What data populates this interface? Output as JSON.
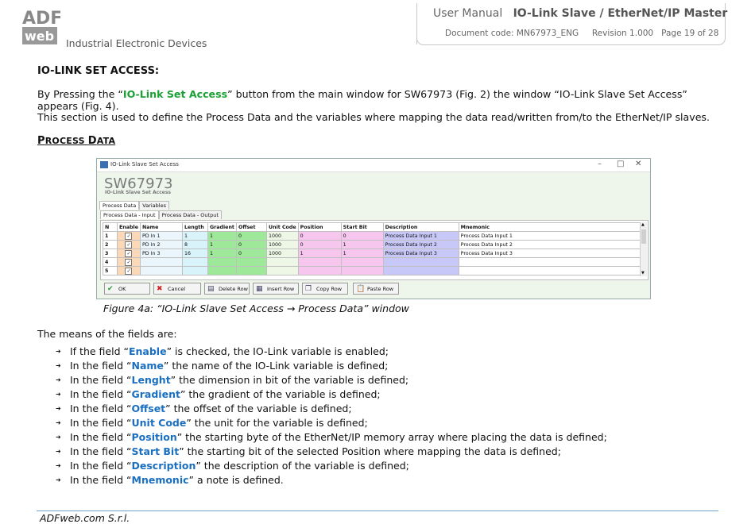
{
  "header": {
    "logo_text": "ADF web",
    "tagline": "Industrial Electronic Devices",
    "manual_label": "User Manual",
    "manual_title": "IO-Link Slave / EtherNet/IP Master",
    "doc_code": "Document code: MN67973_ENG",
    "revision": "Revision 1.000",
    "page": "Page 19 of 28"
  },
  "section": {
    "heading": "IO-LINK SET ACCESS:",
    "para1_a": "By Pressing the “",
    "para1_hl": "IO-Link Set Access",
    "para1_b": "” button from the main window for SW67973 (Fig. 2) the window “IO-Link Slave Set Access” appears (Fig. 4).",
    "para2": "This section is used to define the Process Data and the variables where mapping the data read/written from/to the EtherNet/IP slaves.",
    "subheading_first": "P",
    "subheading_rest": "ROCESS ",
    "subheading_d": "D",
    "subheading_end": "ATA"
  },
  "window": {
    "title": "IO-Link Slave Set Access",
    "app_title": "SW67973",
    "app_subtitle": "IO-Link Slave Set Access",
    "tabs_main": [
      "Process Data",
      "Variables"
    ],
    "tabs_sub": [
      "Process Data - Input",
      "Process Data - Output"
    ],
    "columns": [
      "N",
      "Enable",
      "Name",
      "Length",
      "Gradient",
      "Offset",
      "Unit Code",
      "Position",
      "Start Bit",
      "Description",
      "Mnemonic"
    ],
    "rows": [
      {
        "n": "1",
        "enable": "✓",
        "name": "PD In 1",
        "length": "1",
        "gradient": "1",
        "offset": "0",
        "unit": "1000",
        "position": "0",
        "startbit": "0",
        "desc": "Process Data Input 1",
        "mnem": "Process Data Input 1"
      },
      {
        "n": "2",
        "enable": "✓",
        "name": "PD In 2",
        "length": "8",
        "gradient": "1",
        "offset": "0",
        "unit": "1000",
        "position": "0",
        "startbit": "1",
        "desc": "Process Data Input 2",
        "mnem": "Process Data Input 2"
      },
      {
        "n": "3",
        "enable": "✓",
        "name": "PD In 3",
        "length": "16",
        "gradient": "1",
        "offset": "0",
        "unit": "1000",
        "position": "1",
        "startbit": "1",
        "desc": "Process Data Input 3",
        "mnem": "Process Data Input 3"
      },
      {
        "n": "4",
        "enable": "✓",
        "name": "",
        "length": "",
        "gradient": "",
        "offset": "",
        "unit": "",
        "position": "",
        "startbit": "",
        "desc": "",
        "mnem": ""
      },
      {
        "n": "5",
        "enable": "✓",
        "name": "",
        "length": "",
        "gradient": "",
        "offset": "",
        "unit": "",
        "position": "",
        "startbit": "",
        "desc": "",
        "mnem": ""
      }
    ],
    "buttons": [
      "OK",
      "Cancel",
      "Delete Row",
      "Insert Row",
      "Copy Row",
      "Paste Row"
    ]
  },
  "caption": "Figure 4a: “IO-Link Slave Set Access → Process Data” window",
  "means_intro": "The means of the fields are:",
  "fields": [
    {
      "pre": "If the field “",
      "term": "Enable",
      "post": "” is checked, the IO-Link variable is enabled;"
    },
    {
      "pre": "In the field “",
      "term": "Name",
      "post": "” the name of the IO-Link variable is defined;"
    },
    {
      "pre": "In the field “",
      "term": "Lenght",
      "post": "” the dimension in bit of the variable is defined;"
    },
    {
      "pre": "In the field “",
      "term": "Gradient",
      "post": "” the gradient of the variable is defined;"
    },
    {
      "pre": "In the field “",
      "term": "Offset",
      "post": "” the offset of the variable is defined;"
    },
    {
      "pre": "In the field “",
      "term": "Unit Code",
      "post": "” the unit for the variable is defined;"
    },
    {
      "pre": "In the field “",
      "term": "Position",
      "post": "” the starting byte of the EtherNet/IP memory array where placing the data is defined;"
    },
    {
      "pre": "In the field “",
      "term": "Start Bit",
      "post": "” the starting bit of the selected Position where mapping the data is defined;"
    },
    {
      "pre": "In the field “",
      "term": "Description",
      "post": "” the description of the variable is defined;"
    },
    {
      "pre": "In the field “",
      "term": "Mnemonic",
      "post": "” a note is defined."
    }
  ],
  "footer": "ADFweb.com S.r.l."
}
